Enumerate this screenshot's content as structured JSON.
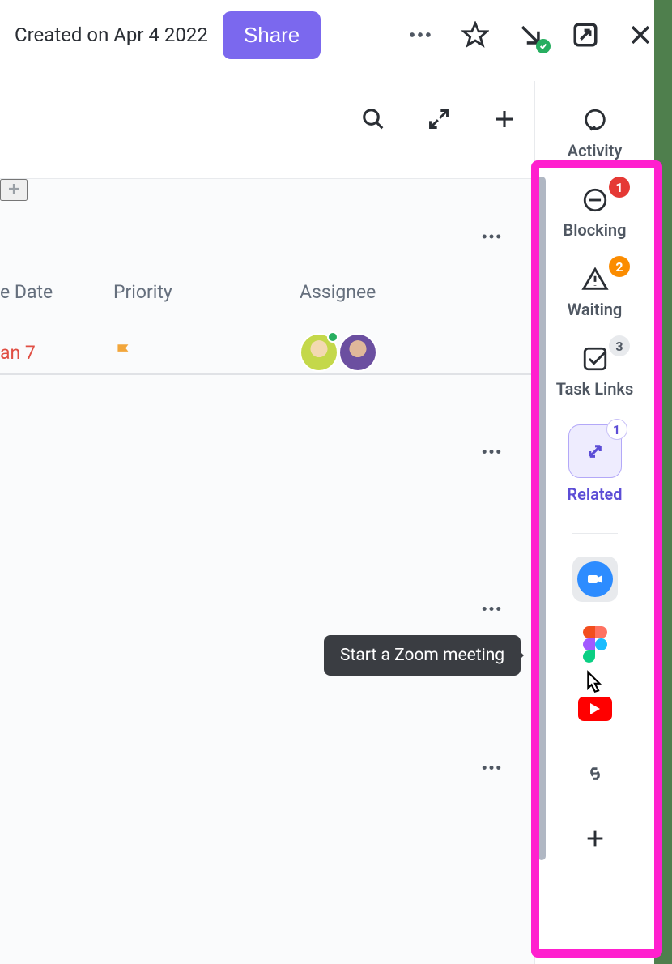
{
  "header": {
    "created_text": "Created on Apr 4 2022",
    "share_label": "Share"
  },
  "toolbar_icons": {
    "more": "more-icon",
    "star": "star-icon",
    "download_ok": "download-check-icon",
    "open_external": "open-external-icon",
    "close": "close-icon"
  },
  "subbar_icons": {
    "search": "search-icon",
    "expand": "expand-icon",
    "add": "plus-icon"
  },
  "columns": {
    "date": "e Date",
    "priority": "Priority",
    "assignee": "Assignee"
  },
  "row": {
    "date": "an 7",
    "priority_icon": "flag-icon"
  },
  "tooltip": "Start a Zoom meeting",
  "rail": {
    "activity": {
      "label": "Activity"
    },
    "blocking": {
      "label": "Blocking",
      "badge": "1"
    },
    "waiting": {
      "label": "Waiting",
      "badge": "2"
    },
    "tasklinks": {
      "label": "Task Links",
      "badge": "3"
    },
    "related": {
      "label": "Related",
      "badge": "1"
    },
    "integrations": {
      "zoom": "zoom-icon",
      "figma": "figma-icon",
      "youtube": "youtube-icon",
      "link": "link-icon",
      "add": "plus-icon"
    }
  }
}
